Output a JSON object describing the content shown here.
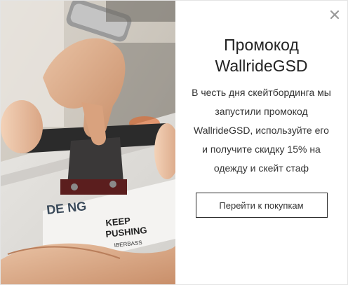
{
  "popup": {
    "title_line1": "Промокод",
    "title_line2": "WallrideGSD",
    "body": "В честь дня скейтбординга мы запустили промокод WallrideGSD, используйте его и получите скидку 15% на одежду и скейт стаф",
    "cta_label": "Перейти к покупкам"
  },
  "image": {
    "deck_text_1": "KEEP",
    "deck_text_2": "PUSHING",
    "deck_text_3": "DE NG",
    "deck_text_4": "IBERBASS",
    "close_icon": "close-icon"
  }
}
